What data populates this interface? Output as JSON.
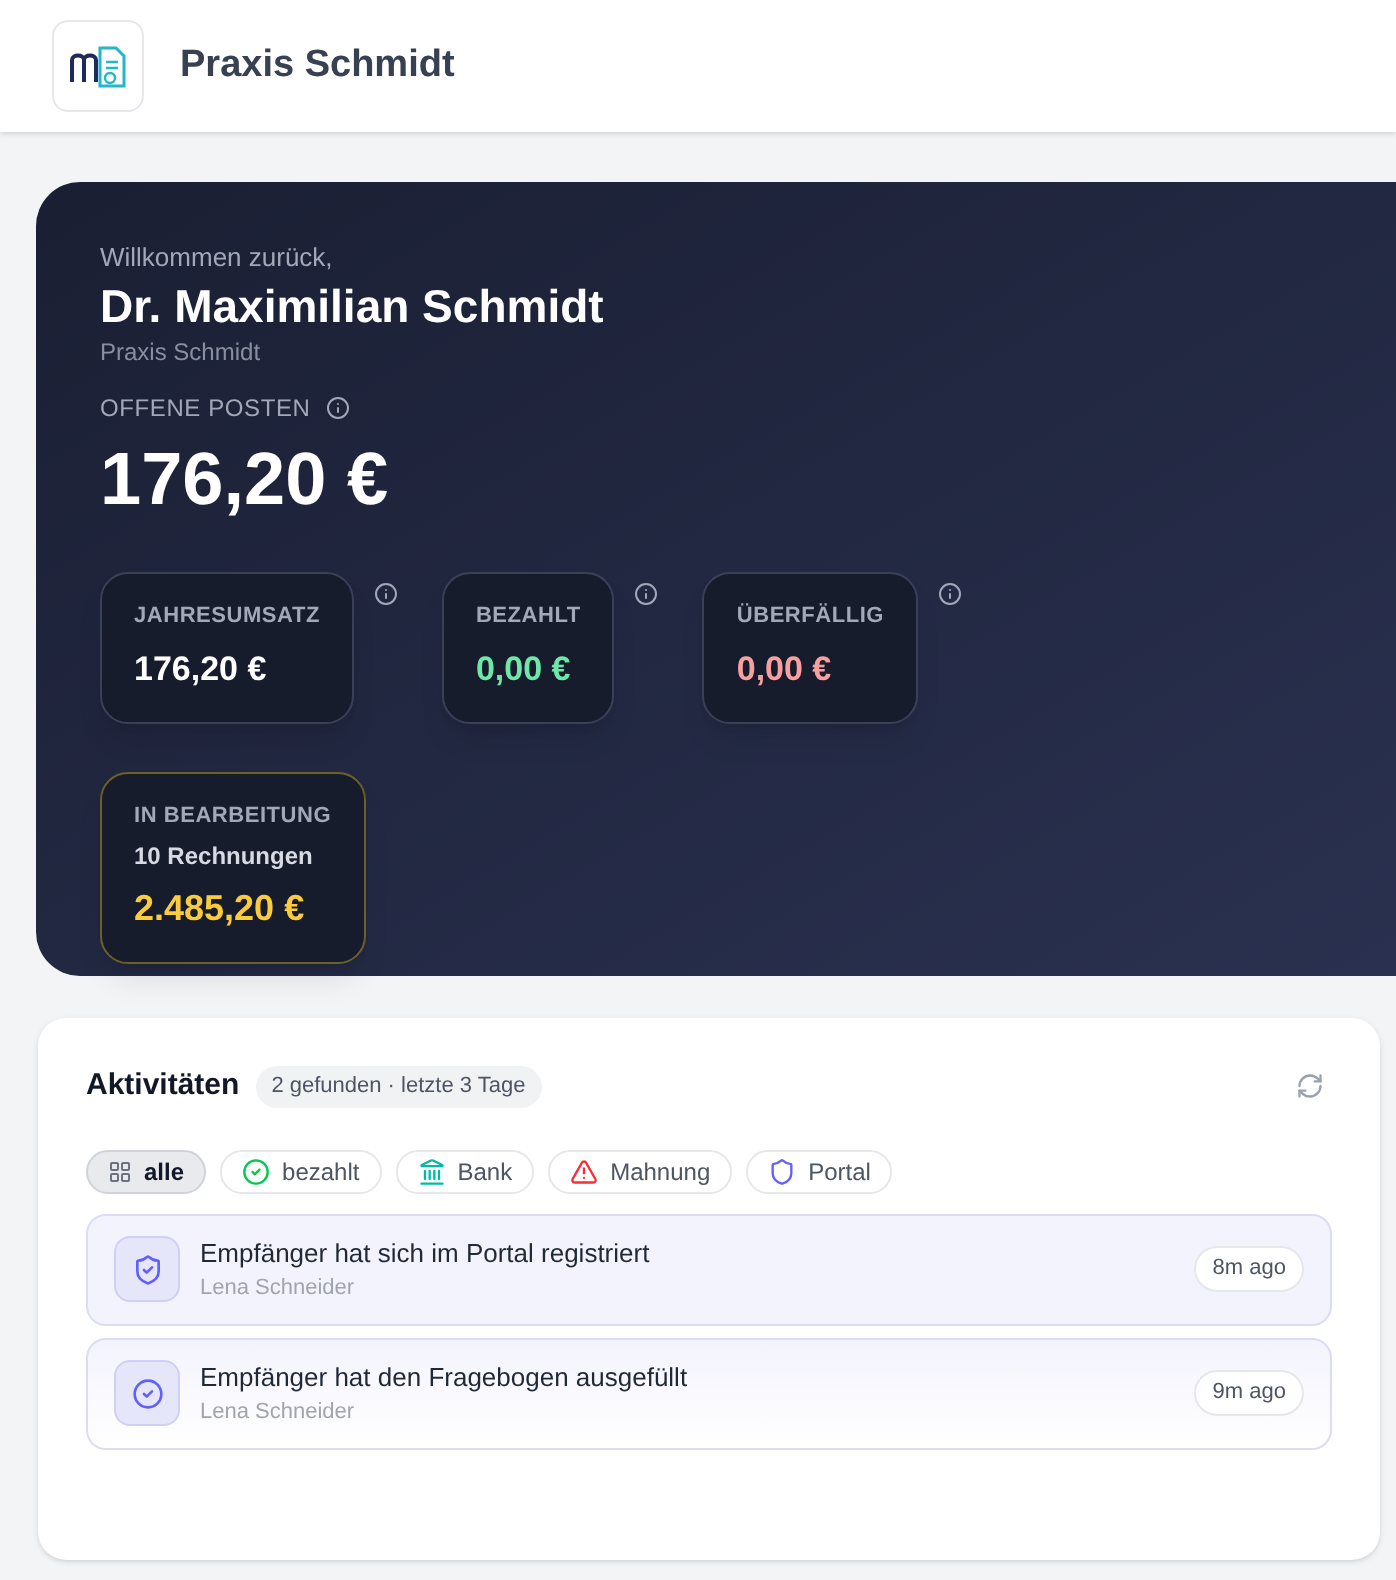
{
  "header": {
    "title": "Praxis Schmidt"
  },
  "hero": {
    "greeting": "Willkommen zurück,",
    "name": "Dr. Maximilian Schmidt",
    "practice": "Praxis Schmidt",
    "open_label": "OFFENE POSTEN",
    "open_amount": "176,20 €",
    "stats": [
      {
        "label": "JAHRESUMSATZ",
        "value": "176,20 €",
        "color": "#ffffff"
      },
      {
        "label": "BEZAHLT",
        "value": "0,00 €",
        "color": "#6ee7a8"
      },
      {
        "label": "ÜBERFÄLLIG",
        "value": "0,00 €",
        "color": "#f8a0a0"
      }
    ],
    "processing": {
      "label": "IN BEARBEITUNG",
      "count": "10 Rechnungen",
      "value": "2.485,20 €"
    }
  },
  "activities": {
    "title": "Aktivitäten",
    "summary": "2 gefunden · letzte 3 Tage",
    "filters": [
      {
        "label": "alle",
        "kind": "all",
        "selected": true
      },
      {
        "label": "bezahlt",
        "kind": "paid",
        "selected": false
      },
      {
        "label": "Bank",
        "kind": "bank",
        "selected": false
      },
      {
        "label": "Mahnung",
        "kind": "reminder",
        "selected": false
      },
      {
        "label": "Portal",
        "kind": "portal",
        "selected": false
      }
    ],
    "items": [
      {
        "title": "Empfänger hat sich im Portal registriert",
        "person": "Lena Schneider",
        "time": "8m ago",
        "kind": "portal"
      },
      {
        "title": "Empfänger hat den Fragebogen ausgefüllt",
        "person": "Lena Schneider",
        "time": "9m ago",
        "kind": "questionnaire"
      }
    ]
  }
}
